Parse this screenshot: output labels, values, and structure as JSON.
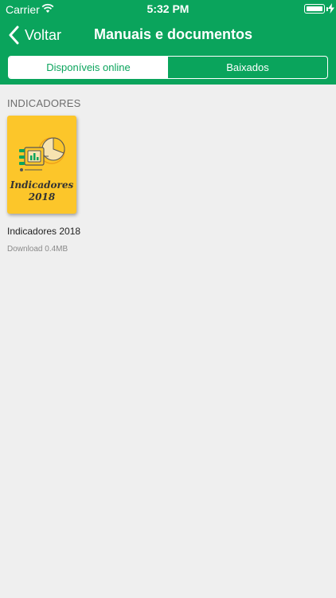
{
  "status_bar": {
    "carrier": "Carrier",
    "time": "5:32 PM",
    "icons": [
      "wifi-icon",
      "battery-icon",
      "charging-bolt-icon"
    ]
  },
  "nav": {
    "back_label": "Voltar",
    "back_icon": "chevron-left-icon",
    "title": "Manuais e documentos"
  },
  "segments": [
    {
      "label": "Disponíveis online",
      "selected": true
    },
    {
      "label": "Baixados",
      "selected": false
    }
  ],
  "section": {
    "title": "INDICADORES"
  },
  "documents": [
    {
      "cover_title_line1": "Indicadores",
      "cover_title_line2": "2018",
      "cover_icon": "dashboard-chart-icon",
      "name": "Indicadores 2018",
      "size": "Download 0.4MB"
    }
  ],
  "colors": {
    "brand_green": "#0aa45c",
    "cover_yellow": "#fcc62a",
    "background": "#efefef"
  }
}
